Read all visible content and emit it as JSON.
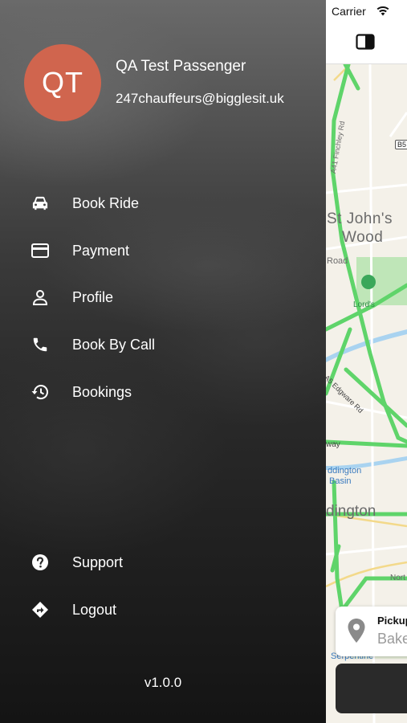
{
  "user": {
    "initials": "QT",
    "name": "QA Test Passenger",
    "email": "247chauffeurs@bigglesit.uk",
    "avatar_color": "#d0654e"
  },
  "menu": {
    "items": [
      {
        "label": "Book Ride",
        "icon": "car-icon"
      },
      {
        "label": "Payment",
        "icon": "credit-card-icon"
      },
      {
        "label": "Profile",
        "icon": "person-icon"
      },
      {
        "label": "Book By Call",
        "icon": "phone-icon"
      },
      {
        "label": "Bookings",
        "icon": "history-icon"
      }
    ],
    "bottom_items": [
      {
        "label": "Support",
        "icon": "help-circle-icon"
      },
      {
        "label": "Logout",
        "icon": "logout-icon"
      }
    ]
  },
  "version": "v1.0.0",
  "status_bar": {
    "carrier": "Carrier"
  },
  "map": {
    "labels": {
      "finchley": "A41 Finchley Rd",
      "b5": "B5",
      "st_johns": "St John's",
      "wood": "Wood",
      "road": "Road",
      "lords": "Lord's",
      "edgware": "A5 Edgware Rd",
      "way": "way",
      "paddington_basin_1": "ddington",
      "paddington_basin_2": "Basin",
      "paddington": "dington",
      "north": "Nort",
      "serpentine": "Serpentine"
    }
  },
  "pickup": {
    "title": "Pickup",
    "value": "Bake"
  },
  "colors": {
    "route": "#5fd46a",
    "water": "#a9d3f0",
    "park": "#b9e3b2"
  }
}
